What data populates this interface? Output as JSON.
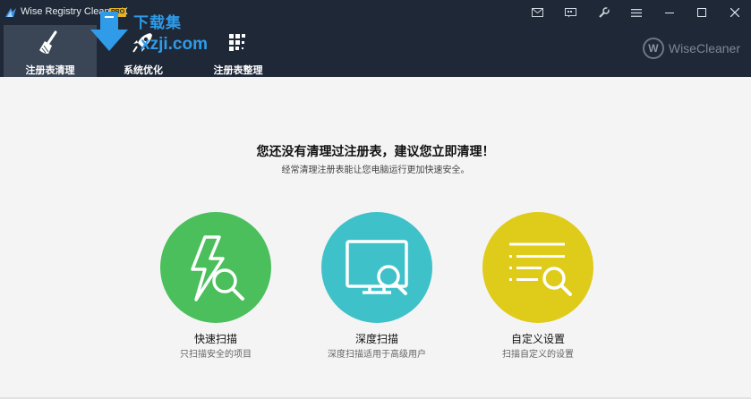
{
  "app": {
    "title": "Wise Registry Cleaner X",
    "badge": "PRO"
  },
  "titlebar_buttons": [
    "mail-icon",
    "feedback-icon",
    "tools-icon",
    "menu-icon",
    "minimize-icon",
    "maximize-icon",
    "close-icon"
  ],
  "tabs": [
    {
      "label": "注册表清理",
      "icon": "broom-icon",
      "active": true
    },
    {
      "label": "系统优化",
      "icon": "rocket-icon",
      "active": false
    },
    {
      "label": "注册表整理",
      "icon": "defrag-blocks-icon",
      "active": false
    }
  ],
  "brand": {
    "logo_letter": "W",
    "name": "WiseCleaner"
  },
  "watermark": {
    "top": "下载集",
    "bottom": "xzji.com"
  },
  "main": {
    "headline": "您还没有清理过注册表，建议您立即清理！",
    "subline": "经常清理注册表能让您电脑运行更加快速安全。",
    "scans": [
      {
        "title": "快速扫描",
        "desc": "只扫描安全的项目",
        "color": "#4bbf5c",
        "icon": "lightning-search-icon"
      },
      {
        "title": "深度扫描",
        "desc": "深度扫描适用于高级用户",
        "color": "#3fc1c9",
        "icon": "monitor-search-icon"
      },
      {
        "title": "自定义设置",
        "desc": "扫描自定义的设置",
        "color": "#dfcb19",
        "icon": "list-search-icon"
      }
    ]
  },
  "colors": {
    "header_bg": "#1f2837",
    "active_tab": "#3a4556",
    "page_bg": "#f4f4f4"
  }
}
